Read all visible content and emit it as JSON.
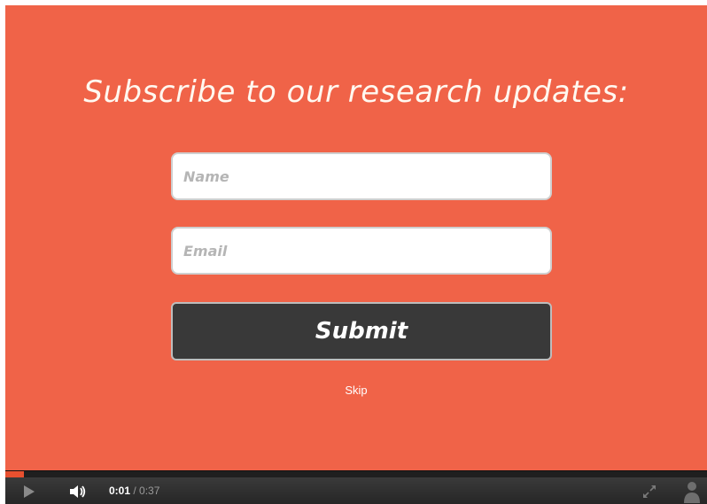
{
  "form": {
    "headline": "Subscribe to our research updates:",
    "name_placeholder": "Name",
    "email_placeholder": "Email",
    "submit_label": "Submit",
    "skip_label": "Skip"
  },
  "player": {
    "current_time": "0:01",
    "duration": "/ 0:37",
    "progress": 0.027,
    "icons": {
      "play": "play-icon",
      "volume": "volume-icon",
      "fullscreen": "fullscreen-icon",
      "user": "user-icon"
    }
  },
  "colors": {
    "background": "#f06348",
    "submit_bg": "#393939",
    "progress_fill": "#e8502f",
    "controls_bg": "#2e2e2e"
  }
}
